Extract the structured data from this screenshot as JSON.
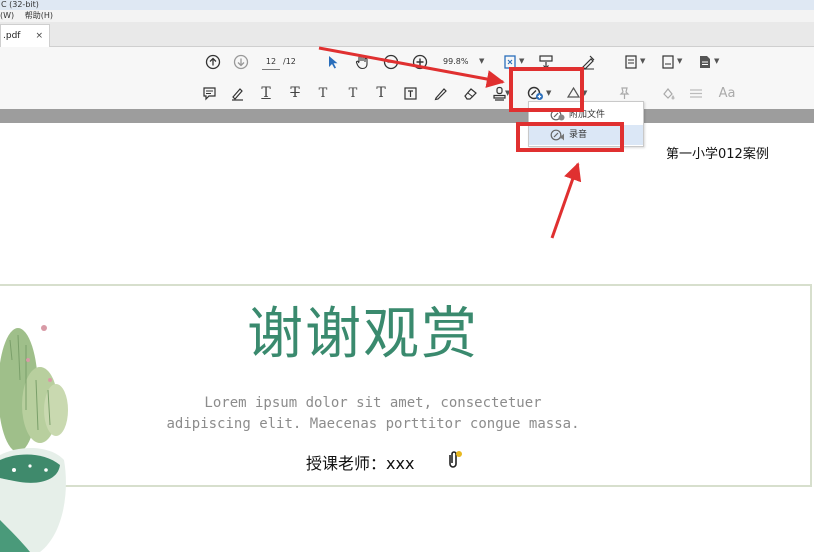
{
  "window": {
    "title_fragment": "C (32-bit)"
  },
  "menubar": {
    "items": [
      "(W)",
      "帮助(H)"
    ]
  },
  "tabs": [
    {
      "label": ".pdf",
      "close": "×"
    }
  ],
  "toolbar": {
    "page_current": "12",
    "page_total": "/12",
    "zoom": "99.8%",
    "text_tool_labels": [
      "T",
      "T",
      "T",
      "T",
      "T"
    ],
    "typewriter_label": "Aa"
  },
  "dropdown": {
    "items": [
      {
        "label": "附加文件",
        "icon": "paperclip-icon"
      },
      {
        "label": "录音",
        "icon": "audio-icon",
        "highlighted": true
      }
    ]
  },
  "document": {
    "caption": "第一小学012案例",
    "title": "谢谢观赏",
    "lorem_line1": "Lorem ipsum dolor sit amet, consectetuer",
    "lorem_line2": "adipiscing elit. Maecenas porttitor congue massa.",
    "teacher": "授课老师：xxx"
  },
  "colors": {
    "annotation_red": "#e03030",
    "title_green": "#3a8a6e",
    "menu_highlight": "#dbe7f6"
  }
}
